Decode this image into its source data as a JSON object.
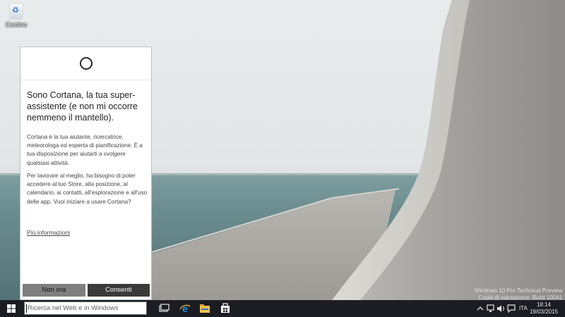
{
  "desktop": {
    "recycle_bin_label": "Cestino",
    "watermark_line1": "Windows 10 Pro Technical Preview",
    "watermark_line2": "Copia di valutazione. Build 10041"
  },
  "cortana": {
    "title": "Sono Cortana, la tua super-assistente (e non mi occorre nemmeno il mantello).",
    "paragraph1": "Cortana è la tua aiutante, ricercatrice, meteorologa ed esperta di pianificazione. È a tua disposizione per aiutarti a svolgere qualsiasi attività.",
    "paragraph2": "Per lavorare al meglio, ha bisogno di poter accedere al tuo Store, alla posizione, al calendario, ai contatti, all'esplorazione e all'uso delle app. Vuoi iniziare a usare Cortana?",
    "more_link": "Più informazioni",
    "decline_label": "Non ora",
    "accept_label": "Consenti"
  },
  "taskbar": {
    "search_placeholder": "Ricerca nel Web e in Windows",
    "language": "ITA",
    "time": "18:14",
    "date": "19/03/2015",
    "icons": [
      "windows-start-icon",
      "task-view-icon",
      "internet-explorer-icon",
      "file-explorer-icon",
      "store-icon"
    ],
    "tray_icons": [
      "chevron-up-icon",
      "network-icon",
      "volume-icon",
      "action-center-icon"
    ]
  },
  "colors": {
    "taskbar": "#1b1d22",
    "button_dark": "#3a3a3a",
    "button_gray": "#7f7f7f",
    "ie_blue": "#1e90e8",
    "folder_yellow": "#f2c14e"
  }
}
